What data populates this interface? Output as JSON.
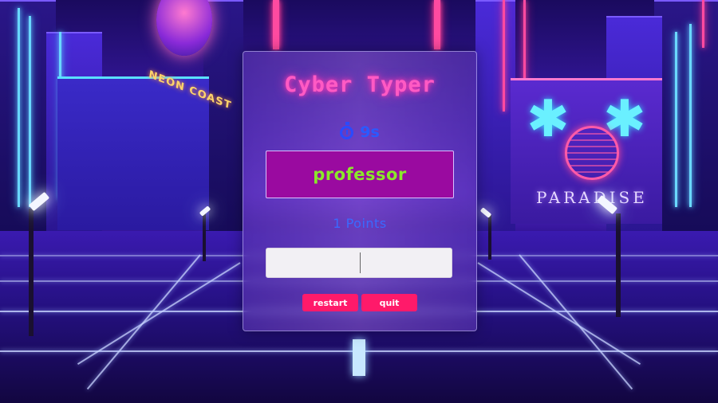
{
  "game": {
    "title": "Cyber Typer",
    "timer_icon": "stopwatch-icon",
    "timer": "9s",
    "current_word": "professor",
    "points": "1 Points",
    "input_value": "",
    "restart_label": "restart",
    "quit_label": "quit"
  },
  "background": {
    "left_sign": "NEON COAST",
    "right_sign": "PARADISE"
  },
  "colors": {
    "title": "#ff5ac4",
    "word_box": "#9a0aa0",
    "word_text": "#8ae82a",
    "accent_blue": "#2a5aff",
    "button": "#ff1a6a"
  }
}
